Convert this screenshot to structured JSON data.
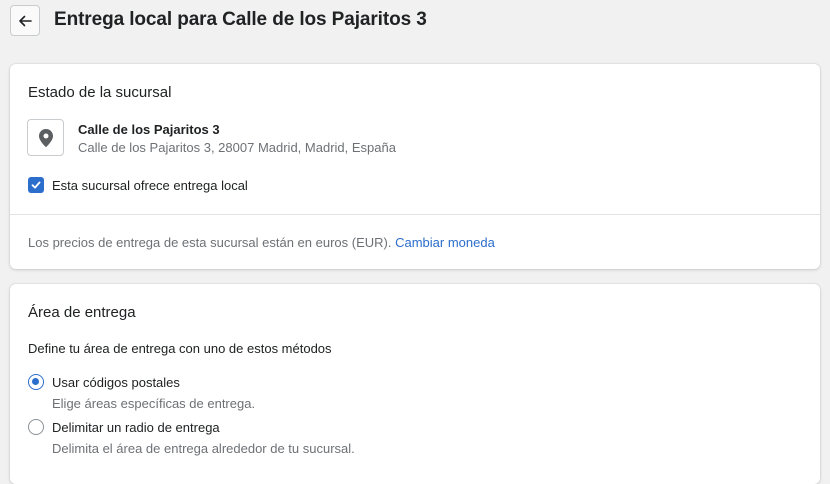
{
  "header": {
    "title": "Entrega local para Calle de los Pajaritos 3",
    "back_icon": "arrow-left-icon"
  },
  "branch_card": {
    "title": "Estado de la sucursal",
    "location_icon": "map-pin-icon",
    "location_name": "Calle de los Pajaritos 3",
    "location_address": "Calle de los Pajaritos 3, 28007 Madrid, Madrid, España",
    "local_delivery_checkbox": {
      "label": "Esta sucursal ofrece entrega local",
      "checked": true
    },
    "currency_text": "Los precios de entrega de esta sucursal están en euros (EUR).",
    "change_currency_link": "Cambiar moneda"
  },
  "area_card": {
    "title": "Área de entrega",
    "intro": "Define tu área de entrega con uno de estos métodos",
    "options": [
      {
        "label": "Usar códigos postales",
        "help": "Elige áreas específicas de entrega.",
        "selected": true
      },
      {
        "label": "Delimitar un radio de entrega",
        "help": "Delimita el área de entrega alrededor de tu sucursal.",
        "selected": false
      }
    ]
  },
  "colors": {
    "accent": "#2c6ecb",
    "background": "#f1f1f1",
    "text": "#202223",
    "subdued_text": "#6d7175"
  }
}
